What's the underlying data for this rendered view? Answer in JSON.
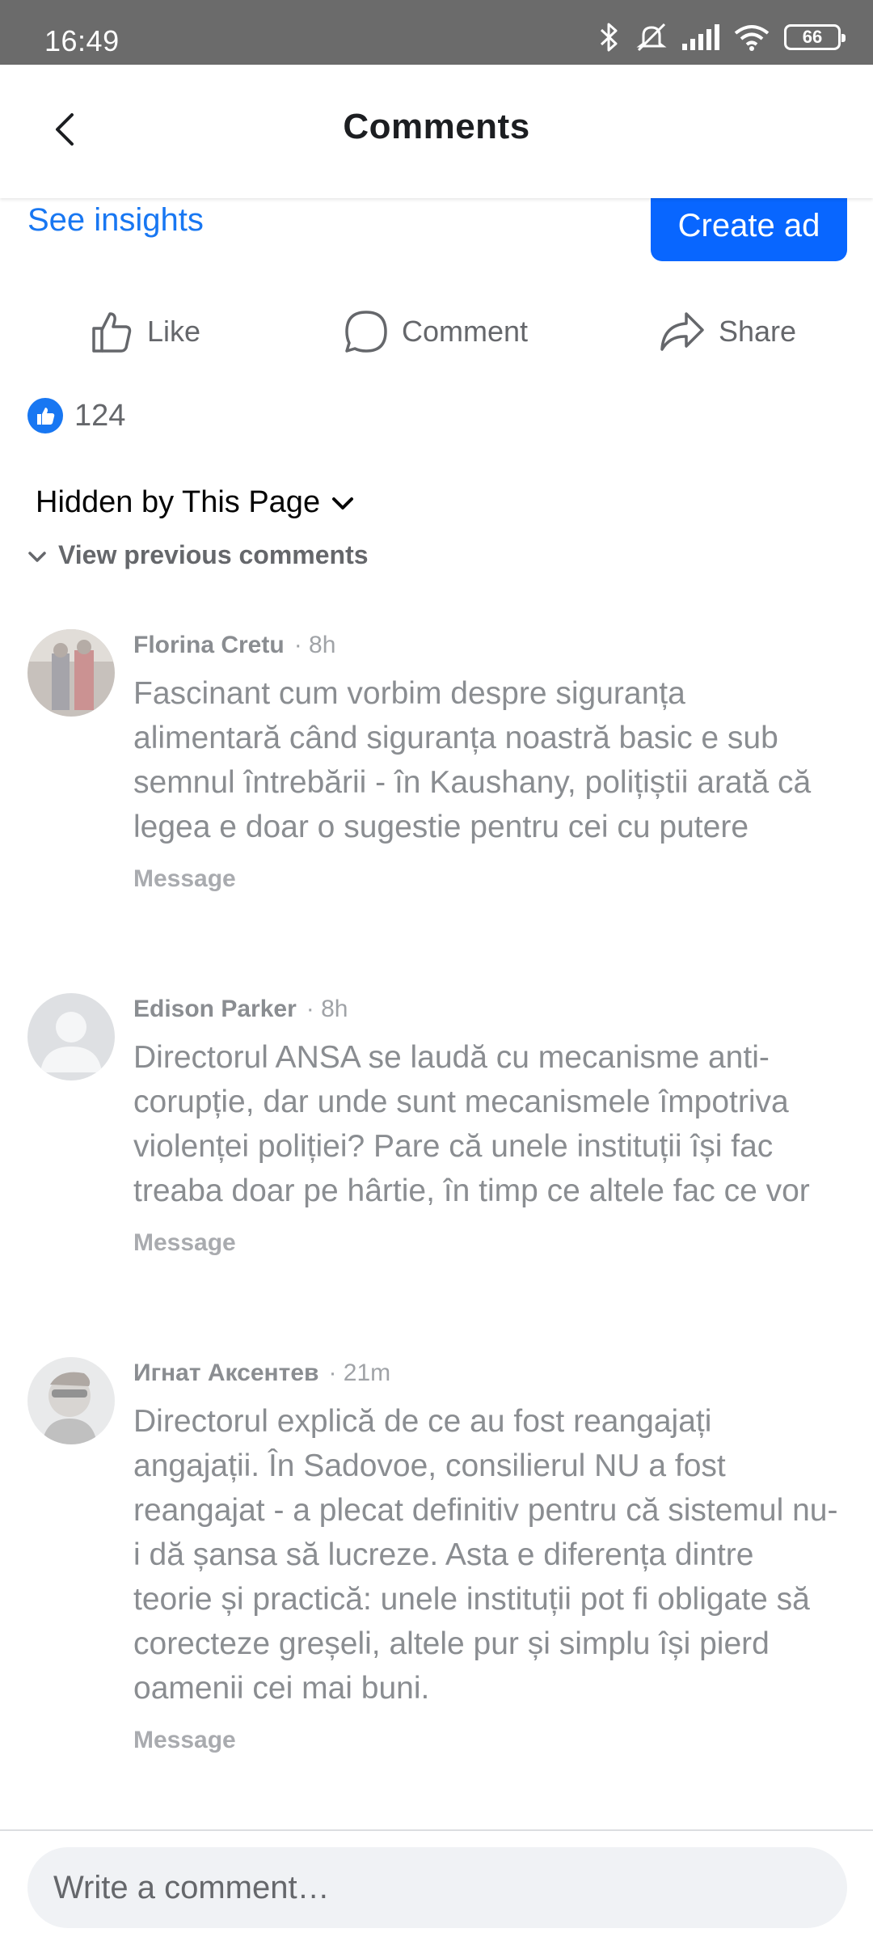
{
  "status_bar": {
    "time": "16:49",
    "battery": "66"
  },
  "header": {
    "title": "Comments"
  },
  "post": {
    "see_insights": "See insights",
    "create_ad": "Create ad",
    "actions": {
      "like": "Like",
      "comment": "Comment",
      "share": "Share"
    },
    "reaction_count": "124"
  },
  "filter": {
    "label": "Hidden by This Page",
    "view_previous": "View previous comments"
  },
  "comments": [
    {
      "author": "Florina Cretu",
      "time": "· 8h",
      "text": "Fascinant cum vorbim despre siguranța alimentară când siguranța noastră basic e sub semnul întrebării - în Kaushany, polițiștii arată că legea e doar o sugestie pentru cei cu putere",
      "action": "Message"
    },
    {
      "author": "Edison Parker",
      "time": "· 8h",
      "text": "Directorul ANSA se laudă cu mecanisme anti-corupție, dar unde sunt mecanismele împotriva violenței poliției? Pare că unele instituții își fac treaba doar pe hârtie, în timp ce altele fac ce vor",
      "action": "Message"
    },
    {
      "author": "Игнат Аксентев",
      "time": "· 21m",
      "text": "Directorul explică de ce au fost reangajați angajații. În Sadovoe, consilierul NU a fost reangajat - a plecat definitiv pentru că sistemul nu-i dă șansa să lucreze. Asta e diferența dintre teorie și practică: unele instituții pot fi obligate să corecteze greșeli, altele pur și simplu își pierd oamenii cei mai buni.",
      "action": "Message"
    }
  ],
  "composer": {
    "placeholder": "Write a comment…"
  },
  "colors": {
    "accent": "#1877f2",
    "button": "#0866ff",
    "muted_text": "#8a8d91"
  }
}
